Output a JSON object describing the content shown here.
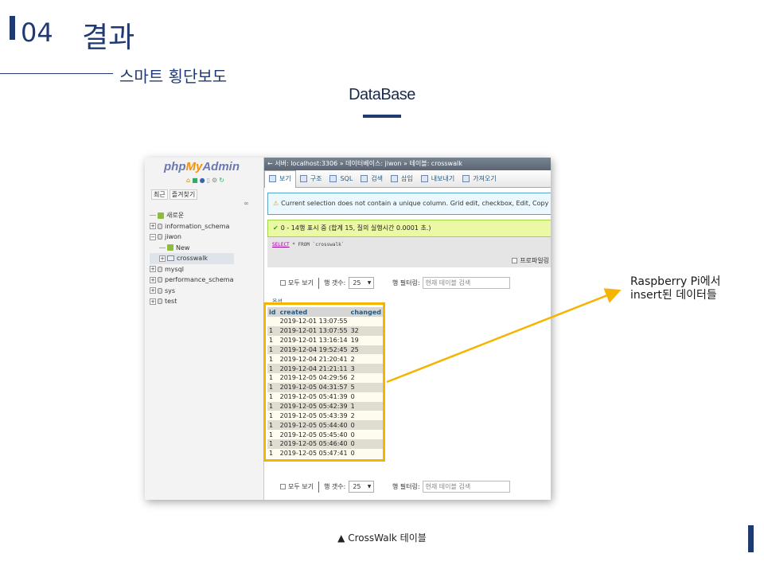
{
  "slide": {
    "section_number": "04",
    "title": "결과",
    "subtitle": "스마트 횡단보도",
    "section_label": "DataBase",
    "annotation_line1": "Raspberry Pi에서",
    "annotation_line2": "insert된 데이터들",
    "caption": "CrossWalk 테이블",
    "caption_icon": "▲",
    "accent_color": "#1f3a73",
    "highlight_color": "#f5b400"
  },
  "pma": {
    "logo": {
      "php": "php",
      "my": "My",
      "admin": "Admin"
    },
    "nav_tabs": [
      "최근",
      "즐겨찾기"
    ],
    "tree": [
      {
        "label": "새로운",
        "type": "new",
        "indent": 0
      },
      {
        "label": "information_schema",
        "type": "db",
        "indent": 0
      },
      {
        "label": "jiwon",
        "type": "db-open",
        "indent": 0
      },
      {
        "label": "New",
        "type": "new",
        "indent": 1
      },
      {
        "label": "crosswalk",
        "type": "table",
        "indent": 1,
        "selected": true
      },
      {
        "label": "mysql",
        "type": "db",
        "indent": 0
      },
      {
        "label": "performance_schema",
        "type": "db",
        "indent": 0
      },
      {
        "label": "sys",
        "type": "db",
        "indent": 0
      },
      {
        "label": "test",
        "type": "db",
        "indent": 0
      }
    ],
    "breadcrumb": "서버: localhost:3306 » 데이터베이스: jiwon » 테이블: crosswalk",
    "tabs": [
      "보기",
      "구조",
      "SQL",
      "검색",
      "삽입",
      "내보내기",
      "가져오기"
    ],
    "warning": "Current selection does not contain a unique column. Grid edit, checkbox, Edit, Copy and",
    "success": "0 - 14행 표시 중 (합계 15, 질의 실행시간 0.0001 초.)",
    "sql_kw": "SELECT",
    "sql_rest": " * FROM `crosswalk`",
    "profiling": "프로파일링",
    "controls": {
      "show_all": "모두 보기",
      "rows_label": "행 갯수:",
      "rows_value": "25",
      "filter_label": "행 필터링:",
      "filter_placeholder": "현재 테이블 검색"
    },
    "options_label": "옵션",
    "columns": [
      "id",
      "created",
      "changed"
    ],
    "rows": [
      [
        "",
        "2019-12-01 13:07:55",
        ""
      ],
      [
        "1",
        "2019-12-01 13:07:55",
        "32"
      ],
      [
        "1",
        "2019-12-01 13:16:14",
        "19"
      ],
      [
        "1",
        "2019-12-04 19:52:45",
        "25"
      ],
      [
        "1",
        "2019-12-04 21:20:41",
        "2"
      ],
      [
        "1",
        "2019-12-04 21:21:11",
        "3"
      ],
      [
        "1",
        "2019-12-05 04:29:56",
        "2"
      ],
      [
        "1",
        "2019-12-05 04:31:57",
        "5"
      ],
      [
        "1",
        "2019-12-05 05:41:39",
        "0"
      ],
      [
        "1",
        "2019-12-05 05:42:39",
        "1"
      ],
      [
        "1",
        "2019-12-05 05:43:39",
        "2"
      ],
      [
        "1",
        "2019-12-05 05:44:40",
        "0"
      ],
      [
        "1",
        "2019-12-05 05:45:40",
        "0"
      ],
      [
        "1",
        "2019-12-05 05:46:40",
        "0"
      ],
      [
        "1",
        "2019-12-05 05:47:41",
        "0"
      ]
    ]
  }
}
